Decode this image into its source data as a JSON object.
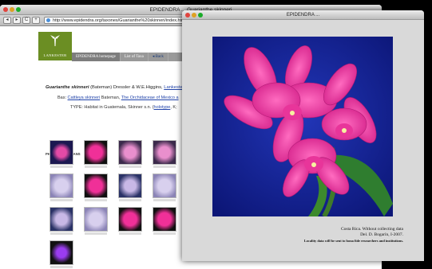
{
  "browser": {
    "title": "EPIDENDRA ... Guarianthe skinneri",
    "url": "http://www.epidendra.org/taxones/Guarianthe%20skinneri/index.html#"
  },
  "site": {
    "logo_text": "LANKESTER",
    "nav": [
      "EPIDENDRA homepage",
      "List of Taxa",
      "◂ Back"
    ]
  },
  "taxon": {
    "name": "Guarianthe skinneri",
    "authors": "(Bateman) Dressler & W.E.Higgins,",
    "ref_link": "Lankester",
    "bas_label": "Bas:",
    "bas_link": "Cattleya skinneri",
    "bas_author": "Bateman,",
    "bas_pub": "The Orchidaceae of Mexico a",
    "type_text": "TYPE: Habitat in Guatemala, Skinner s.n. (",
    "type_link": "holotype",
    "type_tail": ", K;"
  },
  "photos_heading": "PHOTOS AND SCANS",
  "image_window": {
    "title": "EPIDENDRA ...",
    "caption_line1": "Costa Rica. Without collecting data",
    "caption_line2": "Del. D. Bogarín, I-2007.",
    "caption_line3": "Locality data will be sent to bona fide researchers and institutions."
  },
  "nav_buttons": {
    "back": "◂",
    "forward": "▸",
    "reload": "C",
    "add": "+"
  },
  "colors": {
    "logo": "#6b8e23",
    "image_bg": "#15269a",
    "flower": "#e8359a"
  }
}
